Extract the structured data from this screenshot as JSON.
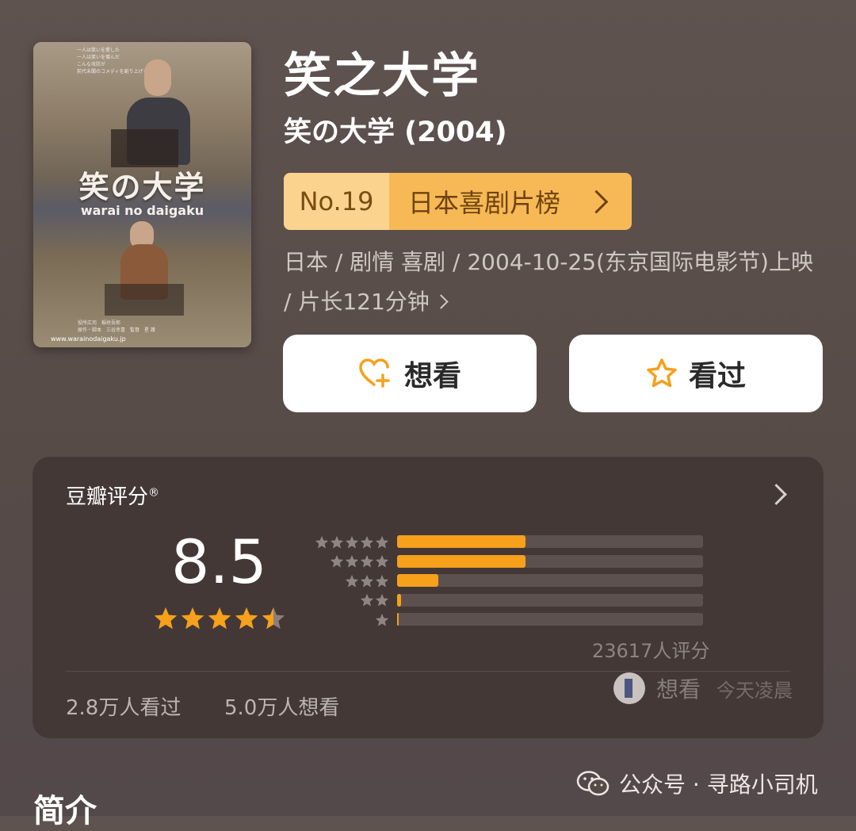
{
  "poster": {
    "blurb": "一人は笑いを愛した\n一人は笑いを憎んだ\nこんな攻防が\n前代未聞のコメディを創り上げる",
    "title": "笑の大学",
    "romaji": "warai no daigaku",
    "credits": "役所広司　稲垣吾郎\n原作・脚本　三谷幸喜　監督　星 護",
    "url": "www.warainodaigaku.jp"
  },
  "movie": {
    "title": "笑之大学",
    "original_title": "笑の大学 (2004)"
  },
  "rank": {
    "number": "No.19",
    "list_name": "日本喜剧片榜"
  },
  "meta": {
    "info": "日本 / 剧情 喜剧 / 2004-10-25(东京国际电影节)上映 / 片长121分钟"
  },
  "actions": {
    "want_label": "想看",
    "seen_label": "看过"
  },
  "rating": {
    "header": "豆瓣评分",
    "reg_mark": "®",
    "score": "8.5",
    "stars_value": 4.5,
    "distribution": [
      {
        "stars": 5,
        "percent": 42
      },
      {
        "stars": 4,
        "percent": 42
      },
      {
        "stars": 3,
        "percent": 13.5
      },
      {
        "stars": 2,
        "percent": 1.2
      },
      {
        "stars": 1,
        "percent": 0.6
      }
    ],
    "count_text": "23617人评分",
    "seen_text": "2.8万人看过",
    "want_text": "5.0万人想看",
    "friend_action": "想看",
    "friend_time": "今天凌晨"
  },
  "section": {
    "intro": "简介"
  },
  "watermark": {
    "text": "公众号 · 寻路小司机"
  },
  "colors": {
    "accent": "#f6a01b",
    "rank_bg": "#f7b955",
    "card_bg": "#433836"
  }
}
